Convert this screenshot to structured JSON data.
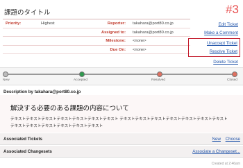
{
  "ticket": {
    "title": "課題のタイトル",
    "number": "#3"
  },
  "properties": [
    {
      "label1": "Priority:",
      "value1": "Highest",
      "label2": "Reporter:",
      "value2": "takahara@port80.co.jp"
    },
    {
      "label1": "",
      "value1": "",
      "label2": "Assigned to:",
      "value2": "takahara@port80.co.jp"
    },
    {
      "label1": "",
      "value1": "",
      "label2": "Milestone:",
      "value2": "<none>"
    },
    {
      "label1": "",
      "value1": "",
      "label2": "Due On:",
      "value2": "<none>"
    }
  ],
  "actions": {
    "edit": "Edit Ticket",
    "comment": "Make a Comment",
    "unaccept": "Unaccept Ticket",
    "resolve": "Resolve Ticket",
    "delete": "Delete Ticket"
  },
  "workflow": {
    "states": [
      {
        "label": "New",
        "color": "#bbbbbb"
      },
      {
        "label": "Accepted",
        "color": "#2e9a4e"
      },
      {
        "label": "Resolved",
        "color": "#e07060"
      },
      {
        "label": "Closed",
        "color": "#e07060"
      }
    ]
  },
  "description": {
    "header": "Description by takahara@port80.co.jp",
    "heading": "解決する必要のある課題の内容について",
    "line1": "テキストテキストテキストテキストテキストテキストテキスト テキストテキストテキストテキストテキストテキストテキスト",
    "line2": "テキストテキストテキストテキストテキストテキスト"
  },
  "associated_tickets": {
    "title": "Associated Tickets",
    "new_label": "New",
    "choose_label": "Choose"
  },
  "associated_changesets": {
    "title": "Associated Changesets",
    "link": "Associate a Changeset..."
  },
  "footer": {
    "created": "Created at 2:46am"
  },
  "colors": {
    "accent": "#e85050",
    "link": "#2255aa",
    "highlight_box": "#c41e2e"
  }
}
